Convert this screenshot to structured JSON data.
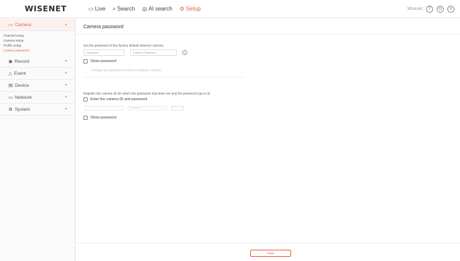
{
  "header": {
    "logo": "WISENET",
    "nav": [
      {
        "icon": "monitor-icon",
        "glyph": "▭",
        "label": "Live"
      },
      {
        "icon": "search-icon",
        "glyph": "⌕",
        "label": "Search"
      },
      {
        "icon": "ai-search-icon",
        "glyph": "◎",
        "label": "AI search"
      },
      {
        "icon": "gear-icon",
        "glyph": "⚙",
        "label": "Setup"
      }
    ],
    "user_label": "Wisenet",
    "accent_color": "#e8603c"
  },
  "sidebar": {
    "menus": [
      {
        "label": "Camera",
        "icon": "camera-icon",
        "glyph": "▭",
        "open": true,
        "items": [
          "Channel setup",
          "Camera setup",
          "Profile setup",
          "Camera password"
        ],
        "active_item": "Camera password"
      },
      {
        "label": "Record",
        "icon": "record-icon",
        "glyph": "◉"
      },
      {
        "label": "Event",
        "icon": "event-icon",
        "glyph": "△"
      },
      {
        "label": "Device",
        "icon": "device-icon",
        "glyph": "▤"
      },
      {
        "label": "Network",
        "icon": "network-icon",
        "glyph": "▭"
      },
      {
        "label": "System",
        "icon": "system-icon",
        "glyph": "⚙"
      }
    ]
  },
  "main": {
    "title": "Camera password",
    "section1": {
      "description": "Set the password of the factory default Wisenet camera.",
      "password_placeholder": "Password",
      "confirm_placeholder": "Confirm Password",
      "show_password_label": "Show password",
      "hint": "Change the password of all (Accessible) camera"
    },
    "section2": {
      "description": "Register the camera ID for which the password had been set and the password (up to 3)",
      "enter_label": "Enter the camera ID and password",
      "ghost_id": "",
      "ghost_password": "Password",
      "ghost_button": "+",
      "show_password_label": "Show password"
    },
    "apply_label": "Apply"
  }
}
